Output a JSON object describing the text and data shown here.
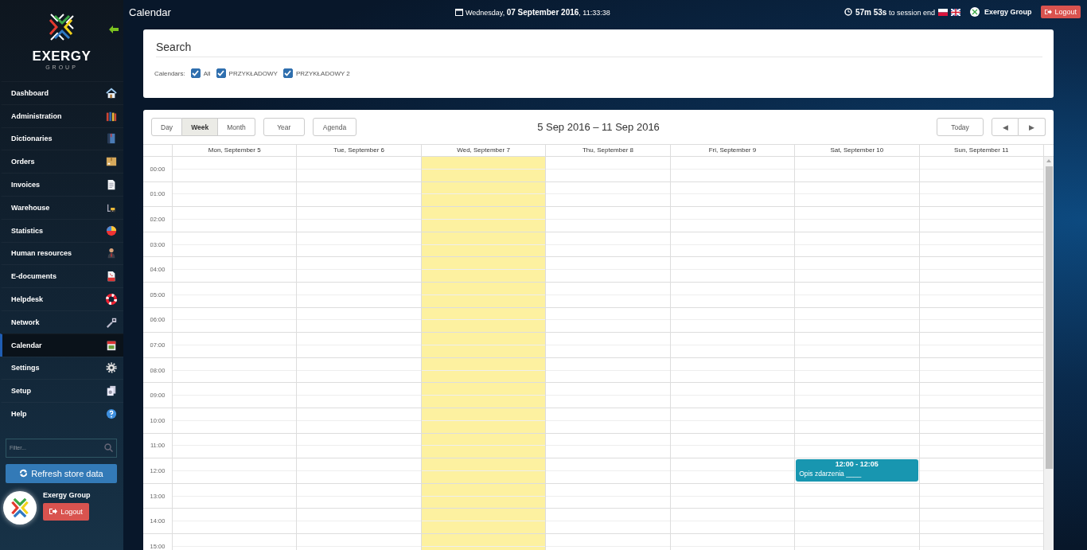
{
  "sidebar": {
    "logo_title": "EXERGY",
    "logo_subtitle": "GROUP",
    "items": [
      {
        "label": "Dashboard",
        "selected": false
      },
      {
        "label": "Administration",
        "selected": false
      },
      {
        "label": "Dictionaries",
        "selected": false
      },
      {
        "label": "Orders",
        "selected": false
      },
      {
        "label": "Invoices",
        "selected": false
      },
      {
        "label": "Warehouse",
        "selected": false
      },
      {
        "label": "Statistics",
        "selected": false
      },
      {
        "label": "Human resources",
        "selected": false
      },
      {
        "label": "E-documents",
        "selected": false
      },
      {
        "label": "Helpdesk",
        "selected": false
      },
      {
        "label": "Network",
        "selected": false
      },
      {
        "label": "Calendar",
        "selected": true
      },
      {
        "label": "Settings",
        "selected": false
      },
      {
        "label": "Setup",
        "selected": false
      },
      {
        "label": "Help",
        "selected": false
      }
    ],
    "filter": {
      "placeholder": "Filter..."
    },
    "refresh_button": "Refresh store data",
    "user": {
      "name": "Exergy Group",
      "logout": "Logout"
    }
  },
  "topbar": {
    "title": "Calendar",
    "datetime": "Wednesday, **07 September 2016**, 11:33:38",
    "session": "**57m 53s** to session end",
    "user": "Exergy Group",
    "logout": "Logout"
  },
  "search": {
    "title": "Search",
    "calendars_label": "Calendars:",
    "calendars": [
      {
        "label": "All",
        "checked": true
      },
      {
        "label": "PRZYKŁADOWY",
        "checked": true
      },
      {
        "label": "PRZYKŁADOWY 2",
        "checked": true
      }
    ]
  },
  "calendar": {
    "view_groups": [
      {
        "buttons": [
          {
            "label": "Day",
            "selected": false
          },
          {
            "label": "Week",
            "selected": true
          },
          {
            "label": "Month",
            "selected": false
          }
        ]
      },
      {
        "buttons": [
          {
            "label": "Year",
            "selected": false
          }
        ]
      },
      {
        "buttons": [
          {
            "label": "Agenda",
            "selected": false
          }
        ]
      }
    ],
    "range_title": "5 Sep 2016 – 11 Sep 2016",
    "today_button": "Today",
    "prev_button": "◀",
    "next_button": "▶",
    "hours": [
      "00:00",
      "01:00",
      "02:00",
      "03:00",
      "04:00",
      "05:00",
      "06:00",
      "07:00",
      "08:00",
      "09:00",
      "10:00",
      "11:00",
      "12:00",
      "13:00",
      "14:00",
      "15:00"
    ],
    "days": [
      {
        "label": "Mon, September 5",
        "today": false
      },
      {
        "label": "Tue, September 6",
        "today": false
      },
      {
        "label": "Wed, September 7",
        "today": true
      },
      {
        "label": "Thu, September 8",
        "today": false
      },
      {
        "label": "Fri, September 9",
        "today": false
      },
      {
        "label": "Sat, September 10",
        "today": false,
        "events": [
          {
            "time": "12:00 - 12:05",
            "title": "Opis zdarzenia ____"
          }
        ]
      },
      {
        "label": "Sun, September 11",
        "today": false
      }
    ]
  }
}
